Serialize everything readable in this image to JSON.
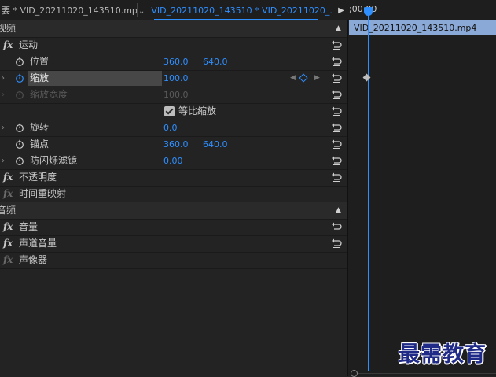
{
  "tabs": {
    "source_tab": "要 * VID_20211020_143510.mp4",
    "active_tab": "VID_20211020_143510 * VID_20211020_..."
  },
  "timeline": {
    "timecode": ";00:00",
    "clip_name": "VID_20211020_143510.mp4"
  },
  "video_section": {
    "title": "视频",
    "motion": {
      "label": "运动",
      "position": {
        "label": "位置",
        "x": "360.0",
        "y": "640.0"
      },
      "scale": {
        "label": "缩放",
        "value": "100.0"
      },
      "scale_width": {
        "label": "缩放宽度",
        "value": "100.0"
      },
      "uniform_scale": {
        "label": "等比缩放",
        "checked": true
      },
      "rotation": {
        "label": "旋转",
        "value": "0.0"
      },
      "anchor": {
        "label": "锚点",
        "x": "360.0",
        "y": "640.0"
      },
      "anti_flicker": {
        "label": "防闪烁滤镜",
        "value": "0.00"
      }
    },
    "opacity": {
      "label": "不透明度"
    },
    "time_remap": {
      "label": "时间重映射"
    }
  },
  "audio_section": {
    "title": "音频",
    "volume": {
      "label": "音量"
    },
    "channel_volume": {
      "label": "声道音量"
    },
    "panner": {
      "label": "声像器"
    }
  },
  "watermark": "最需教育"
}
